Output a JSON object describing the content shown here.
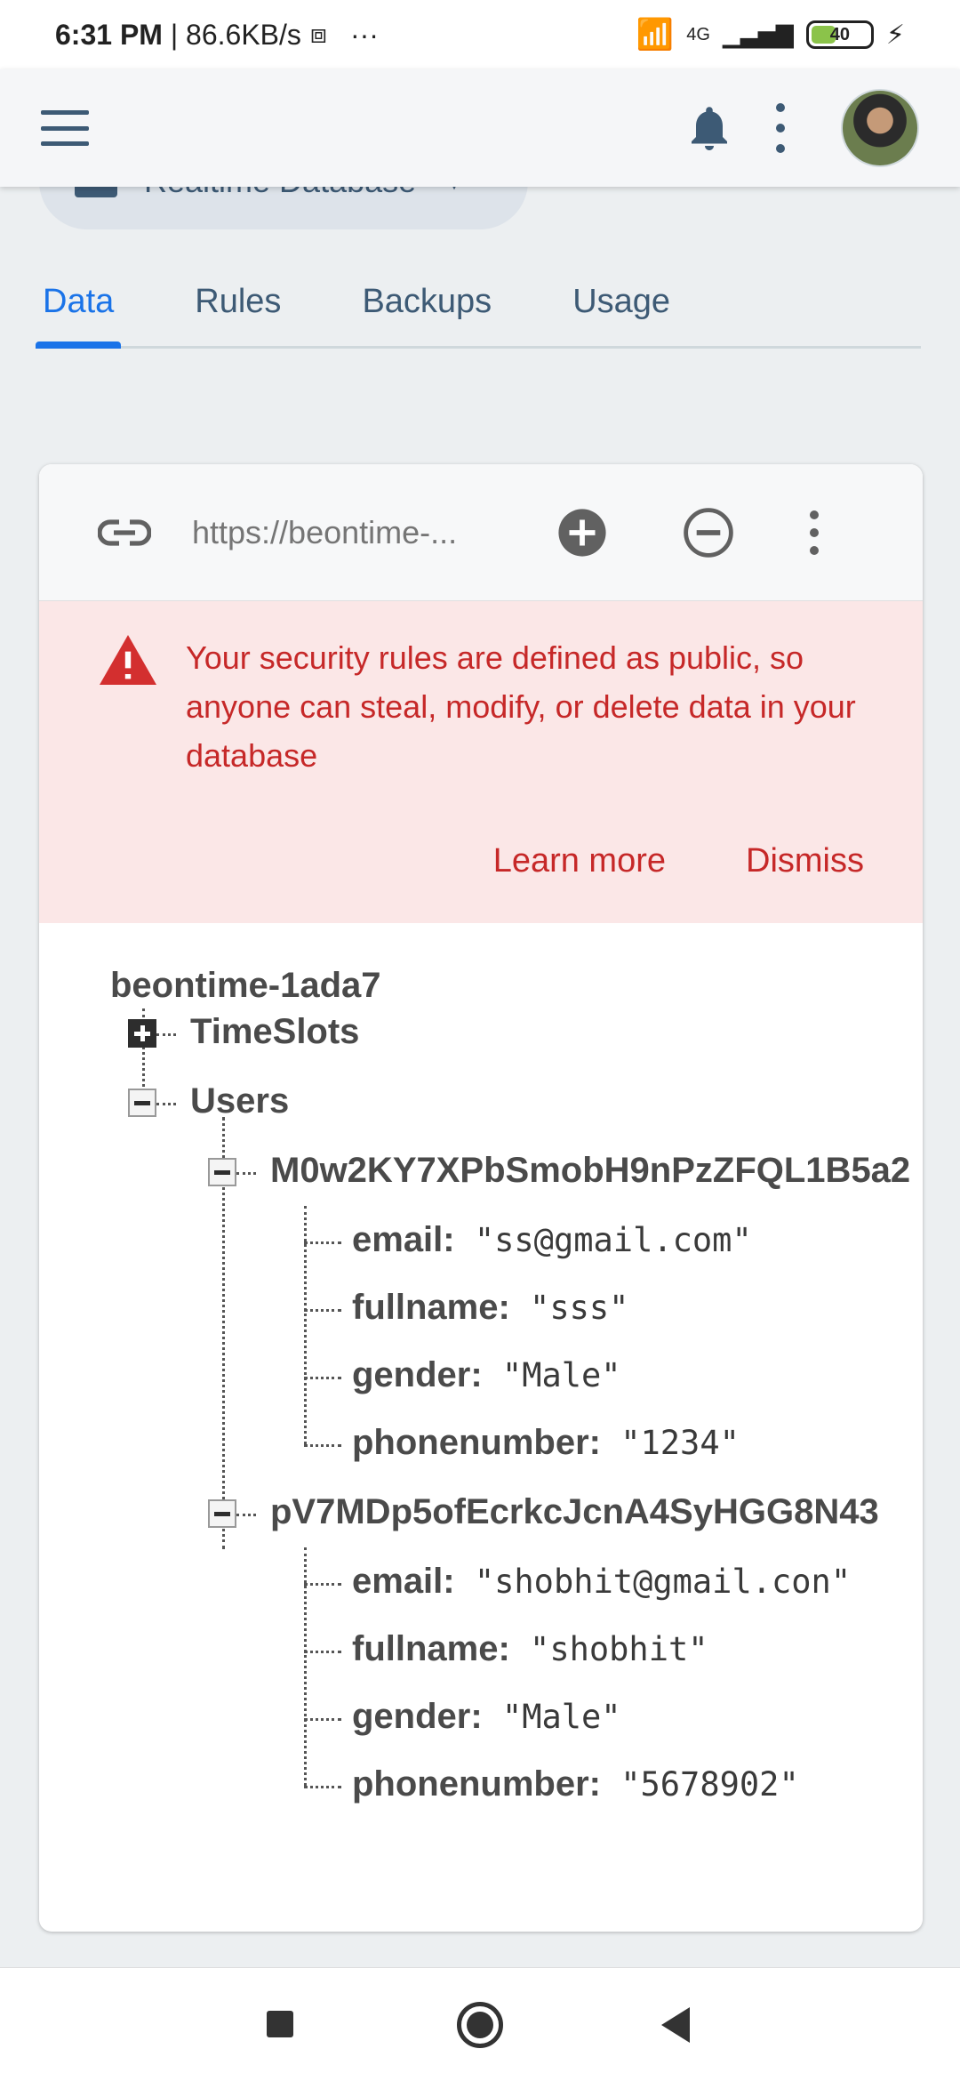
{
  "status_bar": {
    "time": "6:31 PM",
    "speed": "86.6KB/s",
    "more": "···",
    "network": "4G",
    "battery": "40"
  },
  "db_selector": {
    "label": "Realtime Database"
  },
  "tabs": [
    {
      "label": "Data",
      "active": true
    },
    {
      "label": "Rules",
      "active": false
    },
    {
      "label": "Backups",
      "active": false
    },
    {
      "label": "Usage",
      "active": false
    }
  ],
  "toolbar": {
    "url": "https://beontime-..."
  },
  "alert": {
    "message": "Your security rules are defined as public, so anyone can steal, modify, or delete data in your database",
    "learn_more": "Learn more",
    "dismiss": "Dismiss",
    "color": "#c62828"
  },
  "tree": {
    "root": "beontime-1ada7",
    "timeslots": "TimeSlots",
    "users": "Users",
    "records": [
      {
        "key": "M0w2KY7XPbSmobH9nPzZFQL1B5a2",
        "fields": [
          {
            "name": "email",
            "value": "\"ss@gmail.com\""
          },
          {
            "name": "fullname",
            "value": "\"sss\""
          },
          {
            "name": "gender",
            "value": "\"Male\""
          },
          {
            "name": "phonenumber",
            "value": "\"1234\""
          }
        ]
      },
      {
        "key": "pV7MDp5ofEcrkcJcnA4SyHGG8N43",
        "fields": [
          {
            "name": "email",
            "value": "\"shobhit@gmail.con\""
          },
          {
            "name": "fullname",
            "value": "\"shobhit\""
          },
          {
            "name": "gender",
            "value": "\"Male\""
          },
          {
            "name": "phonenumber",
            "value": "\"5678902\""
          }
        ]
      }
    ]
  },
  "colors": {
    "accent": "#1a73e8",
    "nav_text": "#3d5a75"
  }
}
